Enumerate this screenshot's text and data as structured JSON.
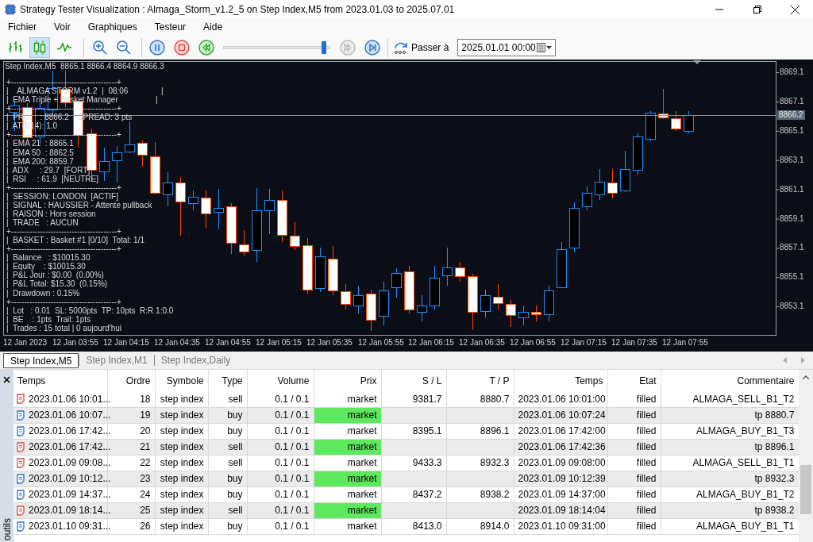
{
  "window": {
    "title": "Strategy Tester Visualization : Almaga_Storm_v1.2_5 on Step Index,M5 from 2023.01.03 to 2025.07.01"
  },
  "menu": [
    "Fichier",
    "Voir",
    "Graphiques",
    "Testeur",
    "Aide"
  ],
  "toolbar": {
    "chart_modes": [
      {
        "selected": false
      },
      {
        "selected": true
      },
      {
        "selected": false
      }
    ],
    "step_buttons": [
      {
        "disabled": true
      },
      {
        "disabled": false
      }
    ],
    "speed": {
      "level": 0.96
    },
    "goto_label": "Passer à",
    "goto_date": "2025.01.01 00:00"
  },
  "chart": {
    "header": "Step Index,M5  8865.1 8866.4 8864.9 8866.3",
    "panel_lines": [
      "+----------------------------------------+",
      "|    ALMAGA STORM v1.2  |  08:06               |",
      "|  EMA Triple + Basket Manager                 |",
      "+----------------------------------------+",
      "|  PRIX    : 8866.2    SPREAD: 3 pts",
      "|  ATR(14): 1.0",
      "+----------------------------------------+",
      "|  EMA 21  : 8865.1",
      "|  EMA 50  : 8862.5",
      "|  EMA 200: 8859.7",
      "|  ADX     : 29.7  [FORT]",
      "|  RSI     : 61.9  [NEUTRE]",
      "+----------------------------------------+",
      "|  SESSION: LONDON  [ACTIF]",
      "|  SIGNAL : HAUSSIER - Attente pullback",
      "|  RAISON : Hors session",
      "|  TRADE   : AUCUN",
      "+----------------------------------------+",
      "|  BASKET : Basket #1 [0/10]  Total: 1/1",
      "+----------------------------------------+",
      "|  Balance   : $10015.30",
      "|  Equity    : $10015.30",
      "|  P&L Jour : $0.00  (0.00%)",
      "|  P&L Total: $15.30  (0.15%)",
      "|  Drawdown : 0.15%",
      "+----------------------------------------+",
      "|  Lot   : 0.01  SL: 5000pts  TP: 10pts  R:R 1:0.0",
      "|  BE    : 1pts  Trail: 1pts",
      "|  Trades : 15 total | 0 aujourd'hui"
    ],
    "price_labels": [
      "8869.1",
      "8867.1",
      "8865.1",
      "8863.1",
      "8861.1",
      "8859.1",
      "8857.1",
      "8855.1",
      "8853.1"
    ],
    "current_price": "8866.2",
    "time_labels": [
      "12 Jan 2023",
      "12 Jan 03:55",
      "12 Jan 04:15",
      "12 Jan 04:35",
      "12 Jan 04:55",
      "12 Jan 05:15",
      "12 Jan 05:35",
      "12 Jan 05:55",
      "12 Jan 06:15",
      "12 Jan 06:35",
      "12 Jan 06:55",
      "12 Jan 07:15",
      "12 Jan 07:35",
      "12 Jan 07:55"
    ]
  },
  "tabs": [
    {
      "label": "Step Index,M5",
      "selected": true
    },
    {
      "label": "Step Index,M1",
      "selected": false
    },
    {
      "label": "Step Index,Daily",
      "selected": false
    }
  ],
  "side_panel": {
    "label": "outils"
  },
  "table": {
    "columns": [
      "Temps",
      "Ordre",
      "Symbole",
      "Type",
      "Volume",
      "Prix",
      "S / L",
      "T / P",
      "Temps",
      "Etat",
      "Commentaire"
    ],
    "rows": [
      {
        "kind": "sell",
        "time": "2023.01.06 10:01...",
        "order": "18",
        "symbol": "step index",
        "type": "sell",
        "volume": "0.1 / 0.1",
        "price": "market",
        "price_hit": false,
        "sl": "9381.7",
        "tp": "8880.7",
        "done_time": "2023.01.06 10:01:00",
        "state": "filled",
        "comment": "ALMAGA_SELL_B1_T2"
      },
      {
        "kind": "buy",
        "time": "2023.01.06 10:07...",
        "order": "19",
        "symbol": "step index",
        "type": "buy",
        "volume": "0.1 / 0.1",
        "price": "market",
        "price_hit": true,
        "done_time": "2023.01.06 10:07:24",
        "state": "filled",
        "comment": "tp 8880.7"
      },
      {
        "kind": "buy",
        "time": "2023.01.06 17:42...",
        "order": "20",
        "symbol": "step index",
        "type": "buy",
        "volume": "0.1 / 0.1",
        "price": "market",
        "price_hit": false,
        "sl": "8395.1",
        "tp": "8896.1",
        "done_time": "2023.01.06 17:42:00",
        "state": "filled",
        "comment": "ALMAGA_BUY_B1_T3"
      },
      {
        "kind": "sell",
        "time": "2023.01.06 17:42...",
        "order": "21",
        "symbol": "step index",
        "type": "sell",
        "volume": "0.1 / 0.1",
        "price": "market",
        "price_hit": true,
        "done_time": "2023.01.06 17:42:36",
        "state": "filled",
        "comment": "tp 8896.1"
      },
      {
        "kind": "sell",
        "time": "2023.01.09 09:08...",
        "order": "22",
        "symbol": "step index",
        "type": "sell",
        "volume": "0.1 / 0.1",
        "price": "market",
        "price_hit": false,
        "sl": "9433.3",
        "tp": "8932.3",
        "done_time": "2023.01.09 09:08:00",
        "state": "filled",
        "comment": "ALMAGA_SELL_B1_T1"
      },
      {
        "kind": "buy",
        "time": "2023.01.09 10:12...",
        "order": "23",
        "symbol": "step index",
        "type": "buy",
        "volume": "0.1 / 0.1",
        "price": "market",
        "price_hit": true,
        "done_time": "2023.01.09 10:12:39",
        "state": "filled",
        "comment": "tp 8932.3"
      },
      {
        "kind": "buy",
        "time": "2023.01.09 14:37...",
        "order": "24",
        "symbol": "step index",
        "type": "buy",
        "volume": "0.1 / 0.1",
        "price": "market",
        "price_hit": false,
        "sl": "8437.2",
        "tp": "8938.2",
        "done_time": "2023.01.09 14:37:00",
        "state": "filled",
        "comment": "ALMAGA_BUY_B1_T2"
      },
      {
        "kind": "sell",
        "time": "2023.01.09 18:14...",
        "order": "25",
        "symbol": "step index",
        "type": "sell",
        "volume": "0.1 / 0.1",
        "price": "market",
        "price_hit": true,
        "done_time": "2023.01.09 18:14:04",
        "state": "filled",
        "comment": "tp 8938.2"
      },
      {
        "kind": "buy",
        "time": "2023.01.10 09:31...",
        "order": "26",
        "symbol": "step index",
        "type": "buy",
        "volume": "0.1 / 0.1",
        "price": "market",
        "price_hit": false,
        "sl": "8413.0",
        "tp": "8914.0",
        "done_time": "2023.01.10 09:31:00",
        "state": "filled",
        "comment": "ALMAGA_BUY_B1_T1"
      }
    ]
  }
}
